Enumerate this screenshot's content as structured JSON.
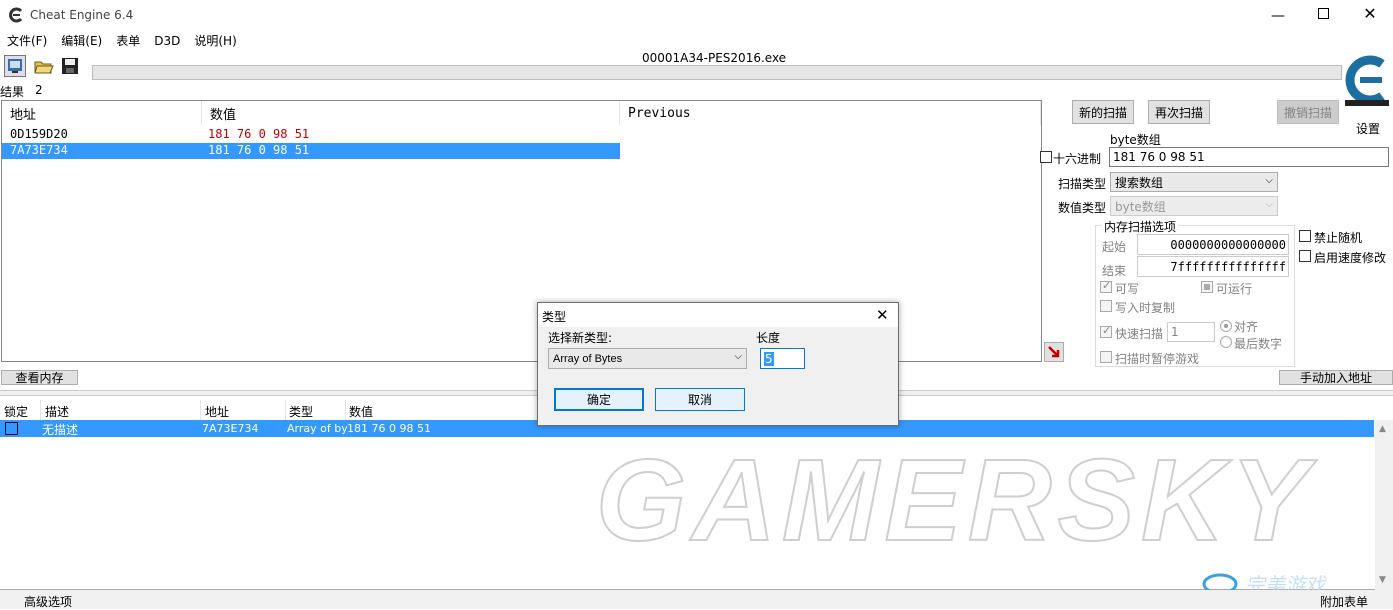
{
  "window": {
    "title": "Cheat Engine 6.4"
  },
  "menu": [
    "文件(F)",
    "编辑(E)",
    "表单",
    "D3D",
    "说明(H)"
  ],
  "process": {
    "name": "00001A34-PES2016.exe"
  },
  "results": {
    "label": "结果",
    "count": "2"
  },
  "found_table": {
    "columns": [
      "地址",
      "数值",
      "Previous"
    ],
    "rows": [
      {
        "address": "0D159D20",
        "value": "181 76 0 98 51"
      },
      {
        "address": "7A73E734",
        "value": "181 76 0 98 51"
      }
    ]
  },
  "scan": {
    "new_scan": "新的扫描",
    "next_scan": "再次扫描",
    "undo_scan": "撤销扫描",
    "settings": "设置",
    "value_group_label": "byte数组",
    "hex_label": "十六进制",
    "value": "181 76 0 98 51",
    "scan_type_label": "扫描类型",
    "scan_type": "搜索数组",
    "value_type_label": "数值类型",
    "value_type": "byte数组"
  },
  "memory_options": {
    "title": "内存扫描选项",
    "start_label": "起始",
    "start_value": "0000000000000000",
    "stop_label": "结束",
    "stop_value": "7fffffffffffffff",
    "writable": "可写",
    "executable": "可运行",
    "copy_on_write": "写入时复制",
    "fast_scan": "快速扫描",
    "fast_scan_value": "1",
    "alignment": "对齐",
    "last_digits": "最后数字",
    "pause_game": "扫描时暂停游戏"
  },
  "extra_options": {
    "disable_random": "禁止随机",
    "enable_speedhack": "启用速度修改"
  },
  "buttons": {
    "view_memory": "查看内存",
    "add_address_manually": "手动加入地址"
  },
  "cheat_table": {
    "columns": [
      "锁定",
      "描述",
      "地址",
      "类型",
      "数值"
    ],
    "rows": [
      {
        "description": "无描述",
        "address": "7A73E734",
        "type": "Array of byte",
        "value": "181 76 0 98 51"
      }
    ]
  },
  "footer": {
    "advanced": "高级选项",
    "table_extras": "附加表单"
  },
  "dialog": {
    "title": "类型",
    "select_type_label": "选择新类型:",
    "selected_type": "Array of Bytes",
    "length_label": "长度",
    "length_value": "5",
    "ok": "确定",
    "cancel": "取消"
  },
  "watermark": "GAMERSKY",
  "watermark_site": "完美游戏",
  "colors": {
    "selection": "#3399ff",
    "value_red": "#c00000",
    "titlebar": "#ffffff"
  }
}
